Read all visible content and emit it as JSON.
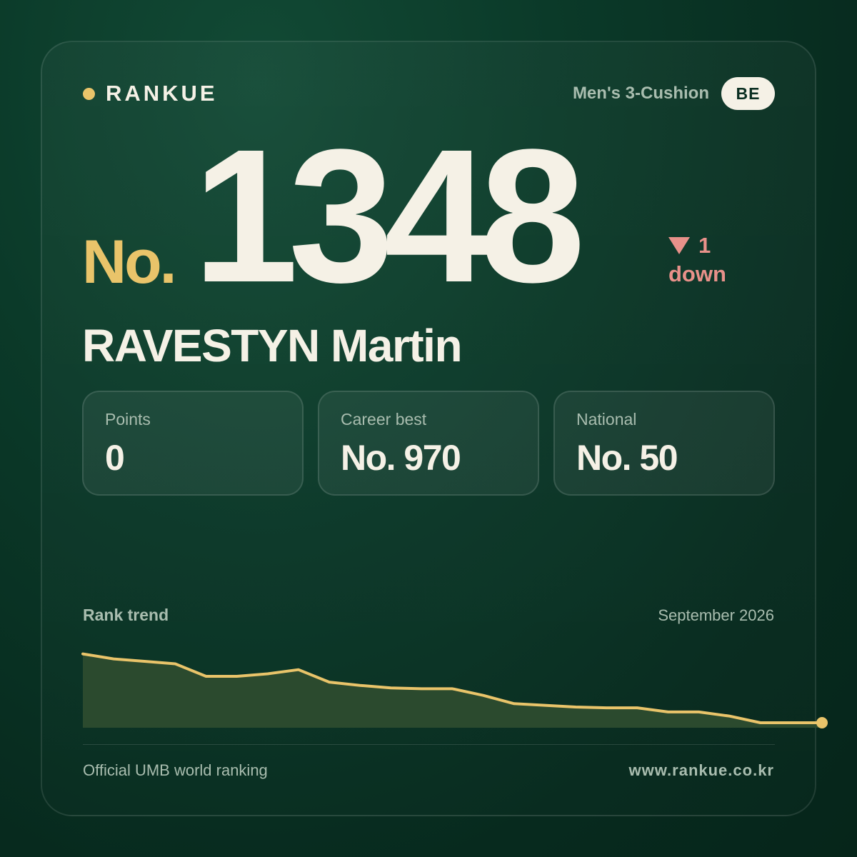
{
  "brand": {
    "name": "RANKUE"
  },
  "header": {
    "category": "Men's 3-Cushion",
    "country": "BE"
  },
  "rank": {
    "prefix": "No.",
    "number": "1348",
    "delta_value": "1",
    "delta_text": "down"
  },
  "player": {
    "name": "RAVESTYN Martin"
  },
  "stats": [
    {
      "label": "Points",
      "value": "0"
    },
    {
      "label": "Career best",
      "value": "No. 970"
    },
    {
      "label": "National",
      "value": "No. 50"
    }
  ],
  "trend": {
    "title": "Rank trend",
    "date": "September 2026"
  },
  "footer": {
    "left": "Official UMB world ranking",
    "right": "www.rankue.co.kr"
  },
  "colors": {
    "accent": "#e9c46a",
    "down": "#e8918a",
    "text": "#f5f1e6",
    "muted": "#a9bdaf"
  },
  "chart_data": {
    "type": "area",
    "title": "Rank trend",
    "series": [
      {
        "values": [
          1256,
          1262,
          1265,
          1268,
          1283,
          1283,
          1280,
          1275,
          1290,
          1294,
          1297,
          1298,
          1298,
          1306,
          1316,
          1318,
          1320,
          1321,
          1321,
          1326,
          1326,
          1331,
          1339,
          1339,
          1339
        ]
      }
    ],
    "ylim": [
      1240,
      1345
    ],
    "y_inverted": true,
    "grid": false,
    "legend": "none"
  }
}
